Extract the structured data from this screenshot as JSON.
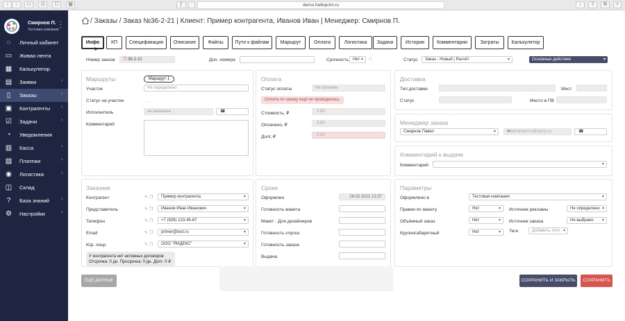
{
  "browser": {
    "url": "demo.helloprint.ru"
  },
  "user": {
    "name": "Смирнов П.",
    "company": "Тестовая компания"
  },
  "nav": [
    {
      "label": "Личный кабинет",
      "icon": "person-icon",
      "chev": false
    },
    {
      "label": "Живая лента",
      "icon": "feed-icon",
      "chev": false
    },
    {
      "label": "Калькулятор",
      "icon": "calculator-icon",
      "chev": false
    },
    {
      "label": "Заявки",
      "icon": "inbox-icon",
      "chev": true
    },
    {
      "label": "Заказы",
      "icon": "document-icon",
      "chev": true
    },
    {
      "label": "Контрагенты",
      "icon": "contacts-icon",
      "chev": true
    },
    {
      "label": "Задачи",
      "icon": "tasks-icon",
      "chev": true
    },
    {
      "label": "Уведомления",
      "icon": "bell-icon",
      "chev": false
    },
    {
      "label": "Касса",
      "icon": "cash-icon",
      "chev": true
    },
    {
      "label": "Платежи",
      "icon": "payments-icon",
      "chev": true
    },
    {
      "label": "Логистика",
      "icon": "location-icon",
      "chev": true
    },
    {
      "label": "Склад",
      "icon": "box-icon",
      "chev": false
    },
    {
      "label": "База знаний",
      "icon": "help-icon",
      "chev": true
    },
    {
      "label": "Настройки",
      "icon": "gear-icon",
      "chev": true
    }
  ],
  "header": {
    "title": "/ Заказы / Заказ №36-2-21 | Клиент: Пример контрагента, Иванов Иван | Менеджер: Смирнов П."
  },
  "tabs": [
    "Инфо",
    "КП",
    "Спецификация",
    "Описание",
    "Файлы",
    "Пути к файлам",
    "Маршрут",
    "Оплата",
    "Логистика",
    "Задачи",
    "История",
    "Комментарии",
    "Затраты",
    "Калькулятор"
  ],
  "order": {
    "number_label": "Номер заказа",
    "number": "36-2-21",
    "extra_label": "Доп. номера",
    "extra": "",
    "urgency_label": "Срочность",
    "urgency": "Нет",
    "status_label": "Статус",
    "status": "Заказ - Новый | Расчёт",
    "actions": "Основные действия"
  },
  "routes": {
    "title": "Маршруты",
    "route_btn": "Маршрут 1",
    "section_label": "Участок",
    "section_placeholder": "Не определено",
    "status_label": "Статус на участке",
    "status": "...",
    "executor_label": "Исполнитель",
    "executor": "не назначен",
    "comment_label": "Комментарий"
  },
  "payment": {
    "title": "Оплата",
    "status_label": "Статус оплаты",
    "status": "Не оплачен",
    "warning": "Оплата по заказу ещё не проводилась",
    "cost_label": "Стоимость, ₽",
    "cost": "0.00",
    "paid_label": "Оплачено, ₽",
    "paid": "0.00",
    "debt_label": "Долг, ₽",
    "debt": "0.00"
  },
  "delivery": {
    "title": "Доставка",
    "type_label": "Тип доставки",
    "places_label": "Мест",
    "status_label": "Статус",
    "pickup_label": "Место в ПВ"
  },
  "manager": {
    "title": "Менеджер заказа",
    "name": "Смирнов Павел",
    "email": "admindemo@demo.ru"
  },
  "issue": {
    "title": "Комментарий к выдаче",
    "comment_label": "Комментарий"
  },
  "customer": {
    "title": "Заказчик",
    "contractor_label": "Контрагент",
    "contractor": "Пример контрагента",
    "rep_label": "Представитель",
    "rep": "Иванов Иван Иванович",
    "phone_label": "Телефон",
    "phone": "+7 (926) 123-45-67",
    "email_label": "Email",
    "email": "primer@test.ru",
    "legal_label": "Юр. лицо",
    "legal": "ООО \"ЯНДЕКС\"",
    "note1": "У контрагента нет активных договоров",
    "note2": "Отсрочка: 0 дн. Просрочка: 0 дн. Долг: 0 ₽"
  },
  "terms": {
    "title": "Сроки",
    "issued_label": "Оформлен",
    "issued": "26.02.2021 12:37",
    "layout_label": "Готовность макета",
    "designer_label": "Макет - Для дизайнеров",
    "launch_label": "Готовность спуска",
    "order_ready_label": "Готовность заказа",
    "delivery_label": "Выдача"
  },
  "params": {
    "title": "Параметры",
    "issued_in_label": "Оформлено в",
    "issued_in": "Тестовая компания",
    "edits_label": "Правки по макету",
    "edits": "Нет",
    "ad_source_label": "Источник рекламы",
    "ad_source": "Не определено",
    "bulk_label": "Объёмный заказ",
    "bulk": "Нет",
    "order_source_label": "Источник заказа",
    "order_source": "Не выбрано",
    "oversize_label": "Крупногабаритный",
    "oversize": "Нет",
    "tags_label": "Теги",
    "tags_placeholder": "Добавить теги"
  },
  "footer": {
    "more": "ЕЩЁ ДАННЫЕ",
    "save_close": "СОХРАНИТЬ И ЗАКРЫТЬ",
    "save": "СОХРАНИТЬ"
  },
  "colors": {
    "sidebar": "#1d2540",
    "sidebar_active": "#3e4a70",
    "save_close": "#454d6a",
    "save": "#d9534f",
    "actions": "#464d6b"
  }
}
